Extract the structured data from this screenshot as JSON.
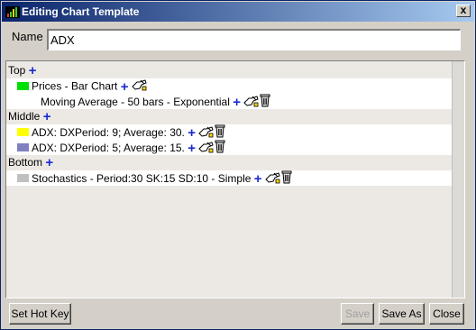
{
  "window": {
    "title": "Editing Chart Template",
    "close_glyph": "x"
  },
  "name": {
    "label": "Name",
    "value": "ADX"
  },
  "sections": [
    {
      "label": "Top",
      "items": [
        {
          "text": "Prices - Bar Chart",
          "color": "#00e000",
          "has_delete": false
        },
        {
          "text": "Moving Average - 50 bars - Exponential",
          "color": null,
          "has_delete": true
        }
      ]
    },
    {
      "label": "Middle",
      "items": [
        {
          "text": "ADX: DXPeriod: 9; Average: 30.",
          "color": "#ffff00",
          "has_delete": true
        },
        {
          "text": "ADX: DXPeriod: 5; Average: 15.",
          "color": "#8080c0",
          "has_delete": true
        }
      ]
    },
    {
      "label": "Bottom",
      "items": [
        {
          "text": "Stochastics -  Period:30 SK:15 SD:10 - Simple",
          "color": "#c0c0c0",
          "has_delete": true
        }
      ]
    }
  ],
  "icons": {
    "add": "plus-icon",
    "edit": "pencil-hand-icon",
    "delete": "trash-can-icon"
  },
  "buttons": {
    "set_hot_key": "Set Hot Key",
    "save": "Save",
    "save_as": "Save As",
    "close": "Close"
  }
}
